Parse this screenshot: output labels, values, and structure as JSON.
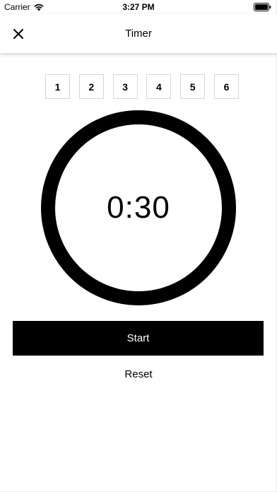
{
  "status_bar": {
    "carrier": "Carrier",
    "time": "3:27 PM",
    "icons": [
      "wifi-icon",
      "battery-icon"
    ]
  },
  "header": {
    "title": "Timer",
    "close_icon": "close-icon"
  },
  "presets": [
    {
      "label": "1"
    },
    {
      "label": "2"
    },
    {
      "label": "3"
    },
    {
      "label": "4"
    },
    {
      "label": "5"
    },
    {
      "label": "6"
    }
  ],
  "timer": {
    "display": "0:30"
  },
  "actions": {
    "start_label": "Start",
    "reset_label": "Reset"
  },
  "colors": {
    "primary": "#000000",
    "background": "#ffffff",
    "border": "#d6d6d6"
  }
}
